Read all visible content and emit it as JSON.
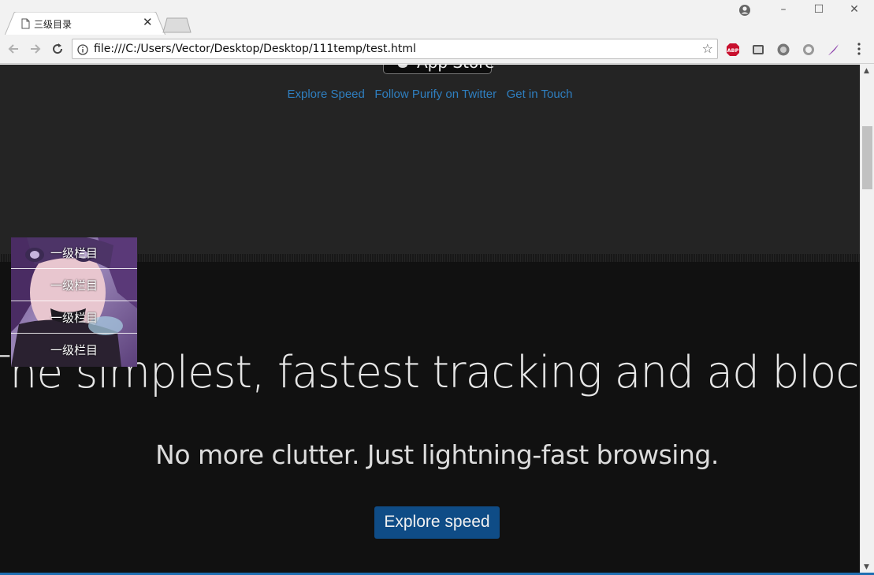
{
  "browser": {
    "tab_title": "三级目录",
    "url": "file:///C:/Users/Vector/Desktop/Desktop/111temp/test.html",
    "window_controls": [
      "minimize",
      "maximize",
      "close"
    ],
    "extensions": [
      "abp-icon",
      "extension-icon-2",
      "extension-icon-3",
      "extension-icon-4",
      "feather-icon"
    ]
  },
  "page": {
    "appstore_label": "App Store",
    "nav_links": [
      "Explore Speed",
      "Follow Purify on Twitter",
      "Get in Touch"
    ],
    "headline": "The simplest, fastest tracking and ad blocker for iOS",
    "subheadline": "No more clutter. Just lightning-fast browsing.",
    "cta_label": "Explore speed",
    "side_menu": [
      "一级栏目",
      "一级栏目",
      "一级栏目",
      "一级栏目"
    ]
  },
  "colors": {
    "page_bg": "#111111",
    "top_section_bg": "#242424",
    "link": "#2f7fc0",
    "cta_bg": "#0f4c86"
  }
}
